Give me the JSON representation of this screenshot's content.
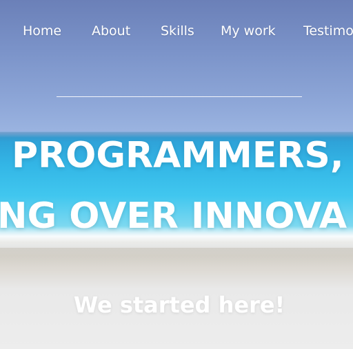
{
  "nav": {
    "items": [
      {
        "label": "Home"
      },
      {
        "label": "About"
      },
      {
        "label": "Skills"
      },
      {
        "label": "My work"
      },
      {
        "label": "Testimo"
      }
    ]
  },
  "hero": {
    "headline_line1": "PROGRAMMERS,",
    "headline_line2": "NG OVER INNOVA",
    "subtitle": "We started here!"
  }
}
